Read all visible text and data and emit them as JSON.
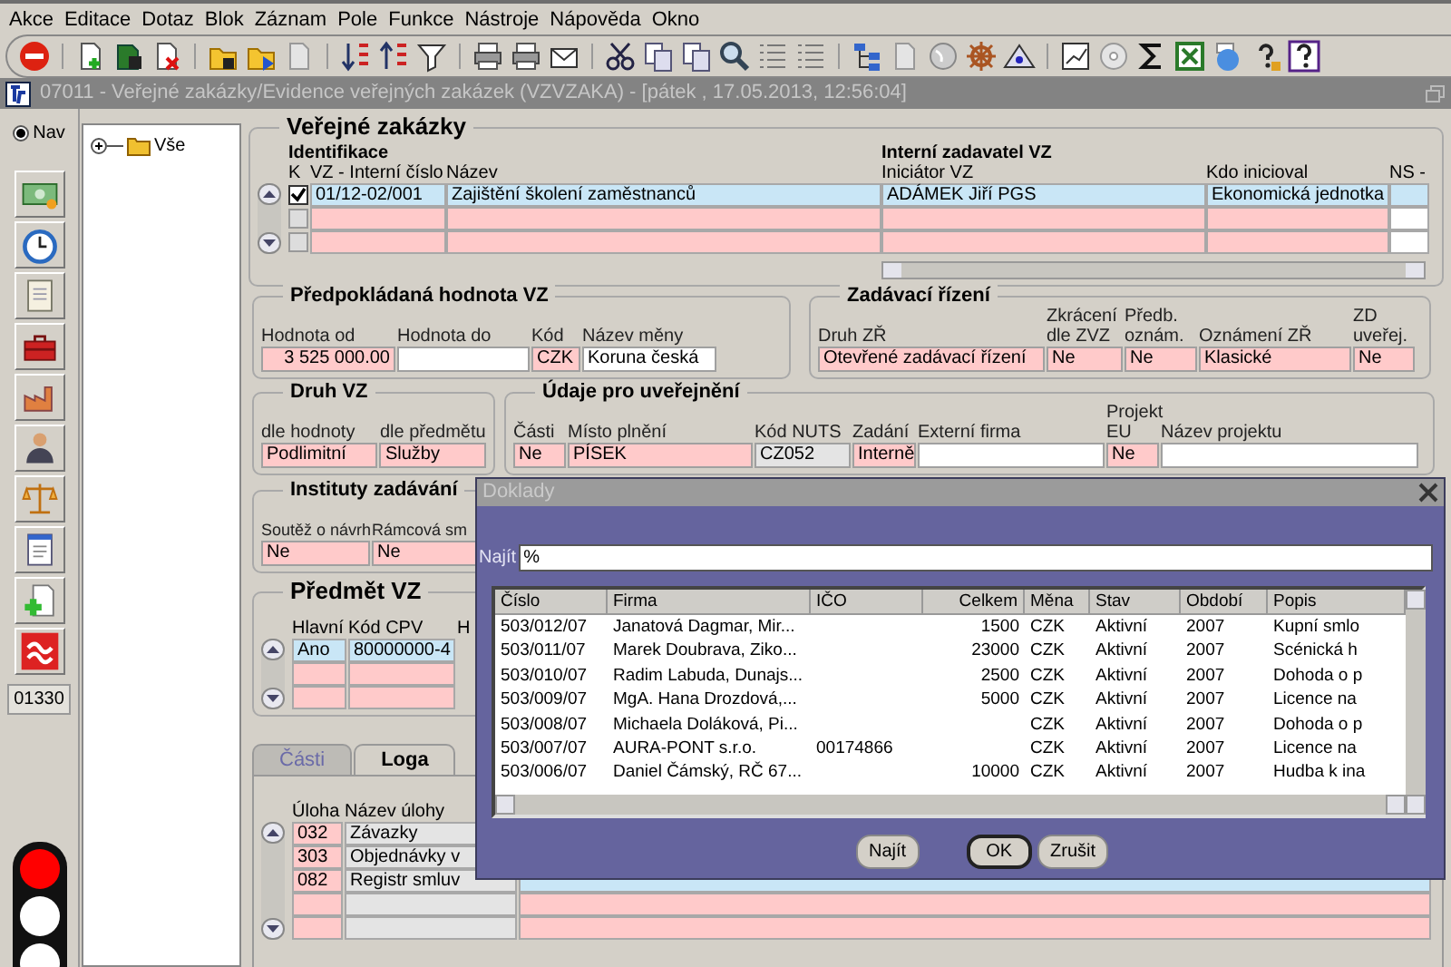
{
  "menu": [
    "Akce",
    "Editace",
    "Dotaz",
    "Blok",
    "Záznam",
    "Pole",
    "Funkce",
    "Nástroje",
    "Nápověda",
    "Okno"
  ],
  "window": {
    "title": "07011 - Veřejné zakázky/Evidence veřejných zakázek (VZVZAKA) - [pátek , 17.05.2013, 12:56:04]"
  },
  "nav": {
    "radio": {
      "label": "Nav",
      "selected": true
    },
    "code": "01330",
    "traffic_light": {
      "red_on": true,
      "amber_on": false,
      "green_on": false
    }
  },
  "tree": [
    {
      "label": "Vše",
      "expanded": false
    }
  ],
  "verejne_zakazky": {
    "title": "Veřejné zakázky",
    "group_headers": [
      "Identifikace",
      "Interní zadavatel VZ"
    ],
    "columns": [
      "K",
      "VZ - Interní číslo",
      "Název",
      "Iniciátor VZ",
      "Kdo inicioval",
      "NS -"
    ],
    "rows": [
      {
        "cells": [
          {
            "kind": "checkbox",
            "checked": true
          },
          {
            "value": "01/12-02/001",
            "kind": "current"
          },
          {
            "value": "Zajištění školení zaměstnanců",
            "kind": "current"
          },
          {
            "value": "ADÁMEK Jiří PGS",
            "kind": "current"
          },
          {
            "value": "Ekonomická jednotka",
            "kind": "current"
          },
          {
            "kind": "current"
          }
        ]
      },
      {
        "cells": [
          {
            "kind": "checkbox",
            "checked": false
          },
          {
            "kind": "required"
          },
          {
            "kind": "required"
          },
          {
            "kind": "required"
          },
          {
            "kind": "required"
          },
          {
            "kind": "optional"
          }
        ]
      },
      {
        "cells": [
          {
            "kind": "checkbox",
            "checked": false
          },
          {
            "kind": "required"
          },
          {
            "kind": "required"
          },
          {
            "kind": "required"
          },
          {
            "kind": "required"
          },
          {
            "kind": "optional"
          }
        ]
      }
    ]
  },
  "predpokladana_hodnota": {
    "title": "Předpokládaná hodnota VZ",
    "fields": [
      {
        "label": "Hodnota od",
        "value": "3 525 000.00",
        "kind": "required"
      },
      {
        "label": "Hodnota do",
        "kind": "optional"
      },
      {
        "label": "Kód",
        "value": "CZK",
        "kind": "required"
      },
      {
        "label": "Název měny",
        "value": "Koruna česká",
        "kind": "optional"
      }
    ]
  },
  "zadavaci_rizeni": {
    "title": "Zadávací řízení",
    "fields": [
      {
        "label": "Druh ZŘ",
        "value": "Otevřené zadávací řízení",
        "kind": "required"
      },
      {
        "label": "Zkrácení dle ZVZ",
        "value": "Ne",
        "kind": "required"
      },
      {
        "label": "Předb. oznám.",
        "value": "Ne",
        "kind": "required"
      },
      {
        "label": "Oznámení ZŘ",
        "value": "Klasické",
        "kind": "required"
      },
      {
        "label": "ZD uveřej.",
        "value": "Ne",
        "kind": "required"
      }
    ]
  },
  "druh_vz": {
    "title": "Druh VZ",
    "fields": [
      {
        "label": "dle hodnoty",
        "value": "Podlimitní",
        "kind": "required"
      },
      {
        "label": "dle předmětu",
        "value": "Služby",
        "kind": "required"
      }
    ]
  },
  "udaje_pro_uverejneni": {
    "title": "Údaje pro uveřejnění",
    "fields": [
      {
        "label": "Části",
        "value": "Ne",
        "kind": "required"
      },
      {
        "label": "Místo plnění",
        "value": "PÍSEK",
        "kind": "required"
      },
      {
        "label": "Kód NUTS",
        "value": "CZ052",
        "kind": "readonly"
      },
      {
        "label": "Zadání",
        "value": "Interně",
        "kind": "required"
      },
      {
        "label": "Externí firma",
        "kind": "optional"
      },
      {
        "label": "Projekt EU",
        "value": "Ne",
        "kind": "required"
      },
      {
        "label": "Název projektu",
        "kind": "optional"
      }
    ]
  },
  "instituty_zadavani": {
    "title": "Instituty zadávání",
    "fields": [
      {
        "label": "Soutěž o návrh",
        "value": "Ne",
        "kind": "required"
      },
      {
        "label": "Rámcová sm",
        "value": "Ne",
        "kind": "required"
      }
    ]
  },
  "predmet_vz": {
    "title": "Předmět VZ",
    "columns": [
      "Hlavní",
      "Kód CPV",
      "H"
    ],
    "rows": [
      {
        "cells": [
          {
            "value": "Ano",
            "kind": "current"
          },
          {
            "value": "80000000-4",
            "kind": "current"
          }
        ]
      },
      {
        "cells": [
          {
            "kind": "required"
          },
          {
            "kind": "required"
          }
        ]
      },
      {
        "cells": [
          {
            "kind": "required"
          },
          {
            "kind": "required"
          }
        ]
      }
    ]
  },
  "tabs": [
    {
      "label": "Části",
      "selected": false
    },
    {
      "label": "Loga",
      "selected": true
    }
  ],
  "loga": {
    "columns": [
      "Úloha",
      "Název úlohy"
    ],
    "rows": [
      {
        "cells": [
          {
            "value": "032",
            "kind": "required"
          },
          {
            "value": "Závazky",
            "kind": "readonly"
          }
        ]
      },
      {
        "cells": [
          {
            "value": "303",
            "kind": "required"
          },
          {
            "value": "Objednávky v",
            "kind": "readonly"
          }
        ]
      },
      {
        "cells": [
          {
            "value": "082",
            "kind": "required"
          },
          {
            "value": "Registr smluv",
            "kind": "readonly"
          },
          {
            "kind": "current"
          }
        ]
      },
      {
        "cells": [
          {
            "kind": "required"
          },
          {
            "kind": "readonly"
          },
          {
            "kind": "required"
          }
        ]
      },
      {
        "cells": [
          {
            "kind": "required"
          },
          {
            "kind": "readonly"
          },
          {
            "kind": "required"
          }
        ]
      }
    ]
  },
  "dialog": {
    "title": "Doklady",
    "search": {
      "label": "Najít",
      "value": "%"
    },
    "columns": [
      "Číslo",
      "Firma",
      "IČO",
      "Celkem",
      "Měna",
      "Stav",
      "Období",
      "Popis"
    ],
    "rows": [
      {
        "number": "503/012/07",
        "company": "Janatová Dagmar, Mir...",
        "total": "1500",
        "currency": "CZK",
        "status": "Aktivní",
        "period": "2007",
        "description": "Kupní smlo"
      },
      {
        "number": "503/011/07",
        "company": "Marek Doubrava, Ziko...",
        "total": "23000",
        "currency": "CZK",
        "status": "Aktivní",
        "period": "2007",
        "description": "Scénická h"
      },
      {
        "number": "503/010/07",
        "company": "Radim Labuda, Dunajs...",
        "total": "2500",
        "currency": "CZK",
        "status": "Aktivní",
        "period": "2007",
        "description": "Dohoda o p"
      },
      {
        "number": "503/009/07",
        "company": "MgA. Hana Drozdová,...",
        "total": "5000",
        "currency": "CZK",
        "status": "Aktivní",
        "period": "2007",
        "description": "Licence na"
      },
      {
        "number": "503/008/07",
        "company": "Michaela Doláková, Pi...",
        "currency": "CZK",
        "status": "Aktivní",
        "period": "2007",
        "description": "Dohoda o p"
      },
      {
        "number": "503/007/07",
        "company": "AURA-PONT s.r.o.",
        "ico": "00174866",
        "currency": "CZK",
        "status": "Aktivní",
        "period": "2007",
        "description": "Licence na"
      },
      {
        "number": "503/006/07",
        "company": "Daniel Čámský, RČ 67...",
        "total": "10000",
        "currency": "CZK",
        "status": "Aktivní",
        "period": "2007",
        "description": "Hudba k ina"
      }
    ],
    "buttons": [
      {
        "label": "Najít",
        "default": false
      },
      {
        "label": "OK",
        "default": true
      },
      {
        "label": "Zrušit",
        "default": false
      }
    ]
  }
}
